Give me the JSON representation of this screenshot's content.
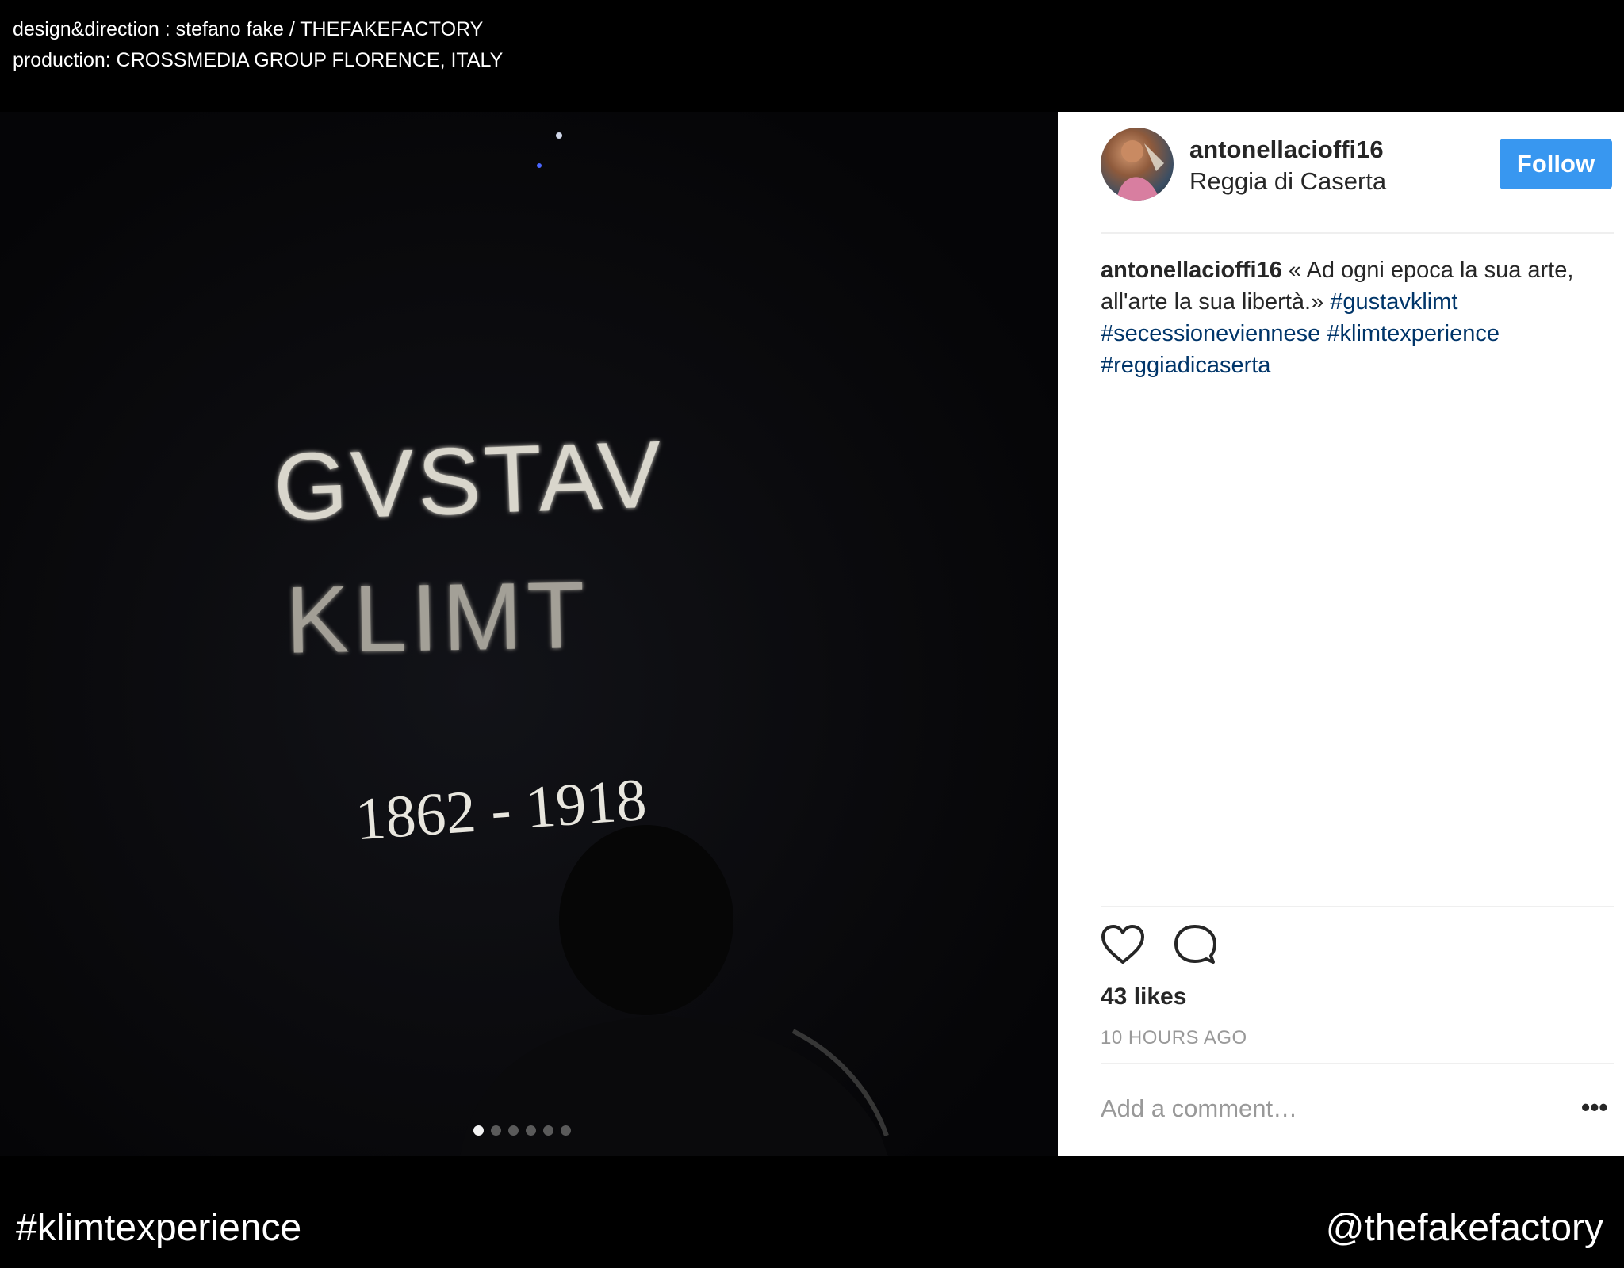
{
  "credits": {
    "line1": "design&direction : stefano fake / THEFAKEFACTORY",
    "line2": "production: CROSSMEDIA GROUP FLORENCE, ITALY"
  },
  "photo": {
    "title_line1": "GVSTAV",
    "title_line2": "KLIMT",
    "years": "1862 - 1918",
    "carousel_count": 6,
    "carousel_active": 1
  },
  "post": {
    "username": "antonellacioffi16",
    "location": "Reggia di Caserta",
    "follow_label": "Follow",
    "caption_user": "antonellacioffi16",
    "caption_text": " « Ad ogni epoca la sua arte, all'arte la sua libertà.» ",
    "tags": [
      "#gustavklimt",
      "#secessioneviennese",
      "#klimtexperience",
      "#reggiadicaserta"
    ],
    "likes": "43 likes",
    "time": "10 HOURS AGO",
    "comment_placeholder": "Add a comment…",
    "more_label": "•••",
    "colors": {
      "follow": "#3897f0",
      "tag": "#003569"
    },
    "icons": [
      "heart-icon",
      "comment-icon"
    ]
  },
  "footer": {
    "hashtag": "#klimtexperience",
    "handle": "@thefakefactory"
  }
}
